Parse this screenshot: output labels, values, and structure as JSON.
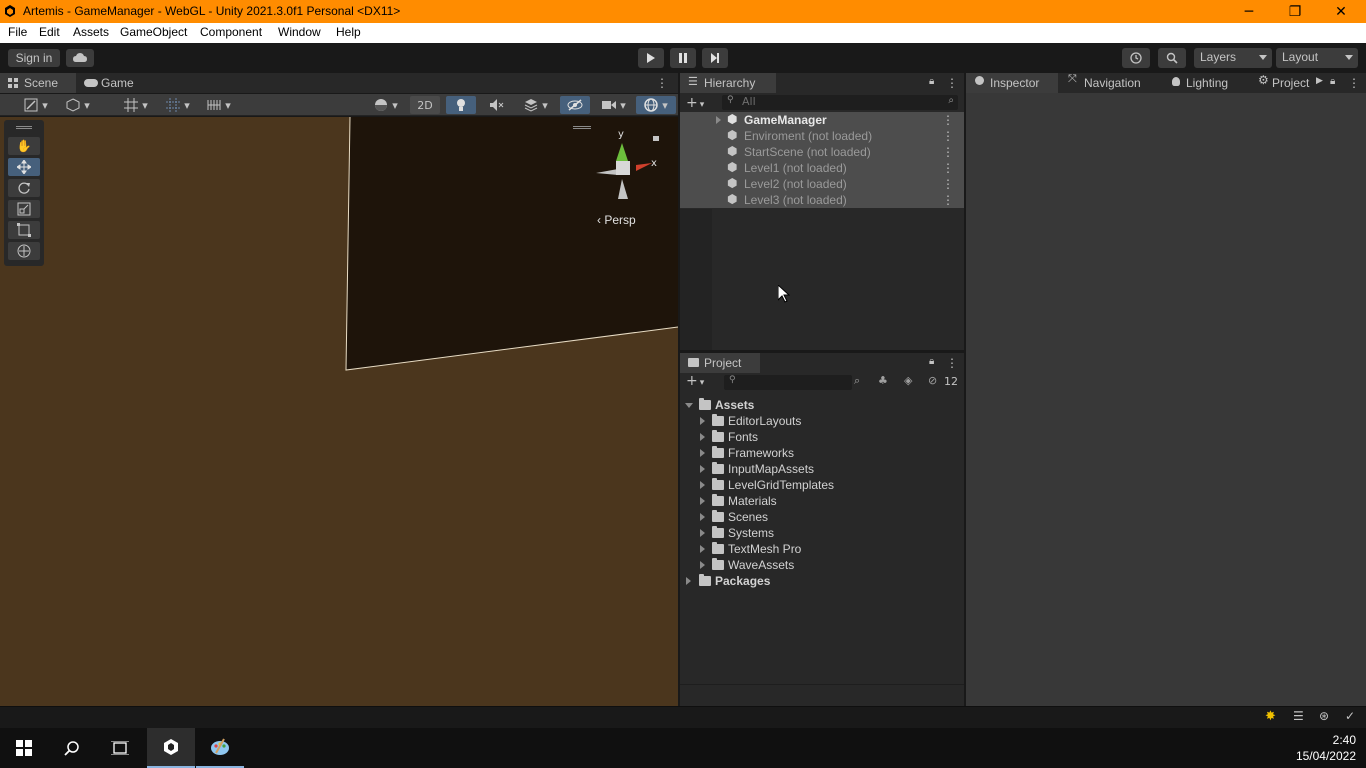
{
  "window": {
    "title": "Artemis - GameManager - WebGL - Unity 2021.3.0f1 Personal <DX11>",
    "minimize": "─",
    "maximize": "❐",
    "close": "✕"
  },
  "menu": {
    "items": [
      "File",
      "Edit",
      "Assets",
      "GameObject",
      "Component",
      "Window",
      "Help"
    ]
  },
  "toolbar": {
    "sign_in": "Sign in",
    "layers": "Layers",
    "layout": "Layout"
  },
  "scene_panel": {
    "tabs": [
      "Scene",
      "Game"
    ],
    "btn_2d": "2D",
    "persp_label": "‹ Persp",
    "gizmo_y": "y",
    "gizmo_x": "x"
  },
  "hierarchy": {
    "tab": "Hierarchy",
    "search_placeholder": "All",
    "rows": [
      {
        "label": "GameManager",
        "loaded": true
      },
      {
        "label": "Enviroment (not loaded)",
        "loaded": false
      },
      {
        "label": "StartScene (not loaded)",
        "loaded": false
      },
      {
        "label": "Level1 (not loaded)",
        "loaded": false
      },
      {
        "label": "Level2 (not loaded)",
        "loaded": false
      },
      {
        "label": "Level3 (not loaded)",
        "loaded": false
      }
    ]
  },
  "project": {
    "tab": "Project",
    "hidden_count": "12",
    "root": "Assets",
    "folders": [
      "EditorLayouts",
      "Fonts",
      "Frameworks",
      "InputMapAssets",
      "LevelGridTemplates",
      "Materials",
      "Scenes",
      "Systems",
      "TextMesh Pro",
      "WaveAssets"
    ],
    "packages": "Packages"
  },
  "inspector": {
    "tabs": [
      "Inspector",
      "Navigation",
      "Lighting",
      "Project"
    ]
  },
  "taskbar": {
    "time": "2:40",
    "date": "15/04/2022"
  },
  "colors": {
    "titlebar": "#ff8c00",
    "scene_bg": "#4b361d",
    "scene_dark": "#1e140a",
    "selection": "#4d4d4d"
  }
}
